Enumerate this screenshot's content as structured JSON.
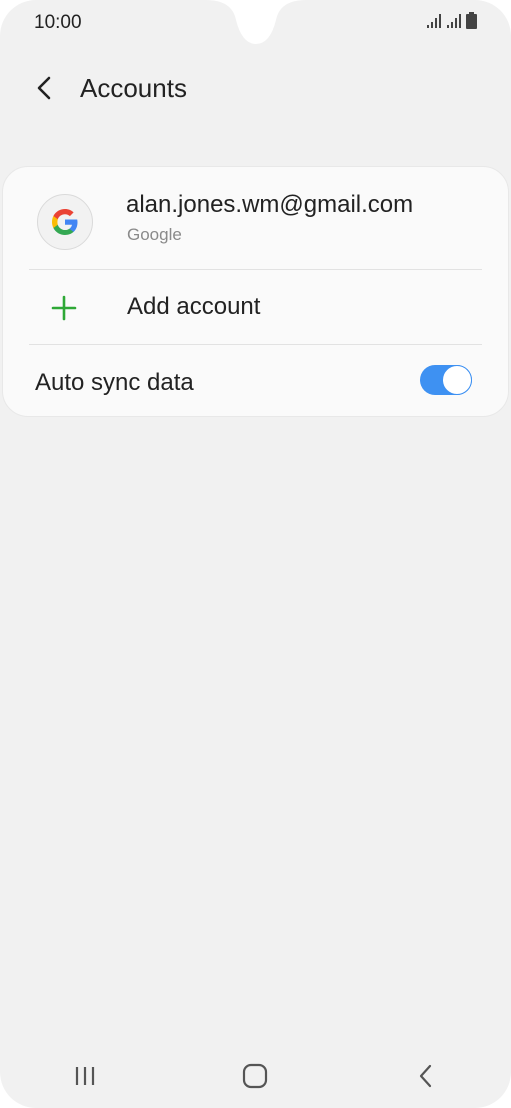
{
  "status_bar": {
    "time": "10:00",
    "icons": [
      "signal-icon",
      "signal-icon",
      "battery-icon"
    ]
  },
  "header": {
    "title": "Accounts",
    "back_icon": "chevron-left-icon"
  },
  "accounts": [
    {
      "email": "alan.jones.wm@gmail.com",
      "type": "Google",
      "icon": "google-icon"
    }
  ],
  "add_account": {
    "label": "Add account",
    "icon": "plus-icon",
    "icon_color": "#2ea836"
  },
  "auto_sync": {
    "label": "Auto sync data",
    "enabled": true,
    "accent": "#3e91f2"
  },
  "nav_bar": {
    "buttons": [
      "recents-icon",
      "home-icon",
      "back-icon"
    ]
  }
}
